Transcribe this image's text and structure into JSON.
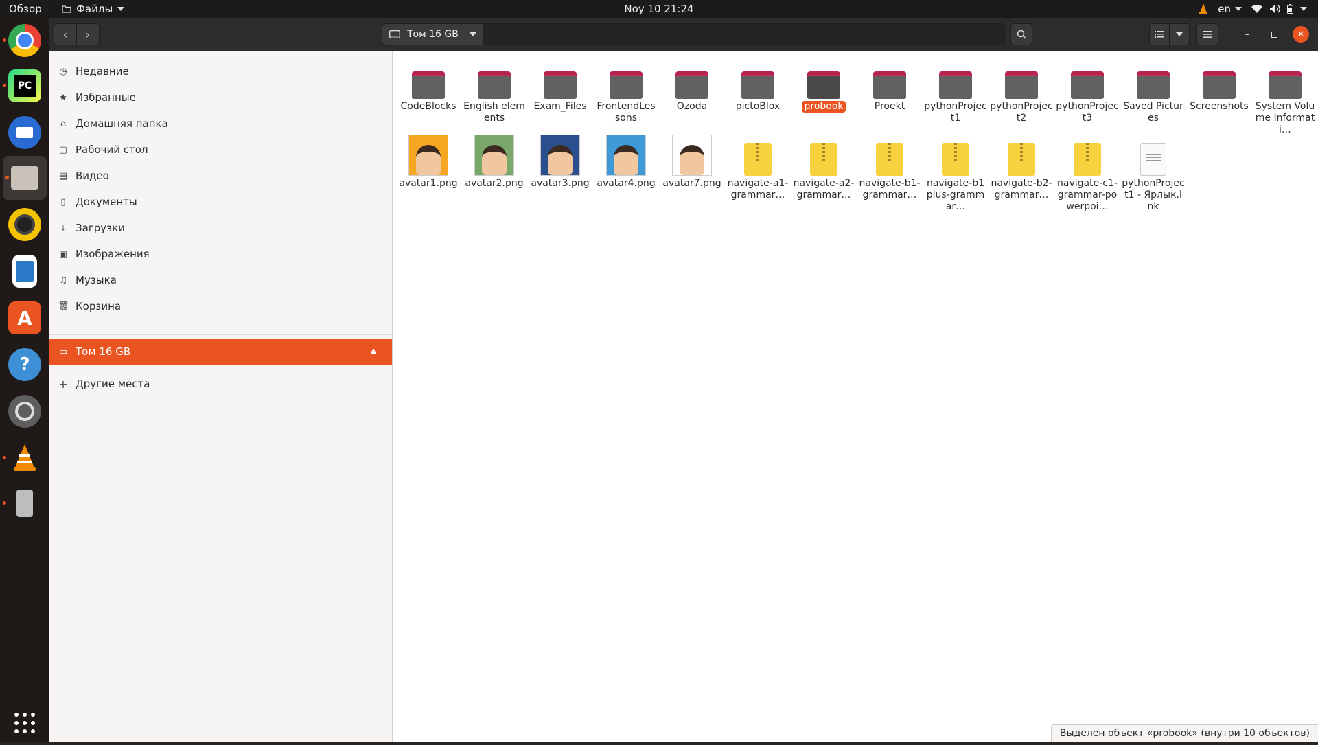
{
  "topbar": {
    "activities": "Обзор",
    "app_menu": "Файлы",
    "clock": "Noy 10  21:24",
    "lang": "en"
  },
  "dock": {
    "apps": [
      {
        "name": "chrome-icon",
        "color": "#4285f4",
        "running": true
      },
      {
        "name": "pycharm-icon",
        "color": "#21d789",
        "running": true
      },
      {
        "name": "thunderbird-icon",
        "color": "#2a6bd3",
        "running": false
      },
      {
        "name": "files-icon",
        "color": "#c9c2b8",
        "running": true
      },
      {
        "name": "rhythmbox-icon",
        "color": "#f5c400",
        "running": false
      },
      {
        "name": "writer-icon",
        "color": "#2a78c8",
        "running": false
      },
      {
        "name": "software-icon",
        "color": "#e95420",
        "running": false
      },
      {
        "name": "help-icon",
        "color": "#3d8fd6",
        "running": false
      },
      {
        "name": "settings-icon",
        "color": "#5e5e5e",
        "running": false
      },
      {
        "name": "vlc-icon",
        "color": "#f08a00",
        "running": true
      },
      {
        "name": "usb-drive-icon",
        "color": "#8a8a8a",
        "running": true
      }
    ]
  },
  "headerbar": {
    "path_label": "Том 16 GB"
  },
  "sidebar": {
    "places": [
      {
        "label": "Недавние",
        "icon": "clock-icon"
      },
      {
        "label": "Избранные",
        "icon": "star-icon"
      },
      {
        "label": "Домашняя папка",
        "icon": "home-icon"
      },
      {
        "label": "Рабочий стол",
        "icon": "desktop-icon"
      },
      {
        "label": "Видео",
        "icon": "video-icon"
      },
      {
        "label": "Документы",
        "icon": "document-icon"
      },
      {
        "label": "Загрузки",
        "icon": "download-icon"
      },
      {
        "label": "Изображения",
        "icon": "image-icon"
      },
      {
        "label": "Музыка",
        "icon": "music-icon"
      },
      {
        "label": "Корзина",
        "icon": "trash-icon"
      }
    ],
    "volume": {
      "label": "Том 16 GB",
      "icon": "drive-icon"
    },
    "other": {
      "label": "Другие места",
      "icon": "plus-icon"
    }
  },
  "files": {
    "row1": [
      {
        "label": "CodeBlocks",
        "type": "folder"
      },
      {
        "label": "English elements",
        "type": "folder"
      },
      {
        "label": "Exam_Files",
        "type": "folder"
      },
      {
        "label": "FrontendLessons",
        "type": "folder"
      },
      {
        "label": "Ozoda",
        "type": "folder"
      },
      {
        "label": "pictoBlox",
        "type": "folder"
      },
      {
        "label": "probook",
        "type": "folder",
        "selected": true
      },
      {
        "label": "Proekt",
        "type": "folder"
      },
      {
        "label": "pythonProject1",
        "type": "folder"
      },
      {
        "label": "pythonProject2",
        "type": "folder"
      },
      {
        "label": "pythonProject3",
        "type": "folder"
      },
      {
        "label": "Saved Pictures",
        "type": "folder"
      },
      {
        "label": "Screenshots",
        "type": "folder"
      },
      {
        "label": "System Volume Informati…",
        "type": "folder"
      }
    ],
    "row2": [
      {
        "label": "avatar1.png",
        "type": "image",
        "color": "#f5a623"
      },
      {
        "label": "avatar2.png",
        "type": "image",
        "color": "#7aa86a"
      },
      {
        "label": "avatar3.png",
        "type": "image",
        "color": "#2b4e8c"
      },
      {
        "label": "avatar4.png",
        "type": "image",
        "color": "#3d9ad6"
      },
      {
        "label": "avatar7.png",
        "type": "image",
        "color": "#ffffff"
      },
      {
        "label": "navigate-a1-grammar…",
        "type": "zip"
      },
      {
        "label": "navigate-a2-grammar…",
        "type": "zip"
      },
      {
        "label": "navigate-b1-grammar…",
        "type": "zip"
      },
      {
        "label": "navigate-b1plus-grammar…",
        "type": "zip"
      },
      {
        "label": "navigate-b2-grammar…",
        "type": "zip"
      },
      {
        "label": "navigate-c1-grammar-powerpoi…",
        "type": "zip"
      },
      {
        "label": "pythonProject1 - Ярлык.lnk",
        "type": "doc"
      }
    ]
  },
  "status": "Выделен объект «probook» (внутри 10 объектов)",
  "colors": {
    "accent": "#e95420"
  }
}
